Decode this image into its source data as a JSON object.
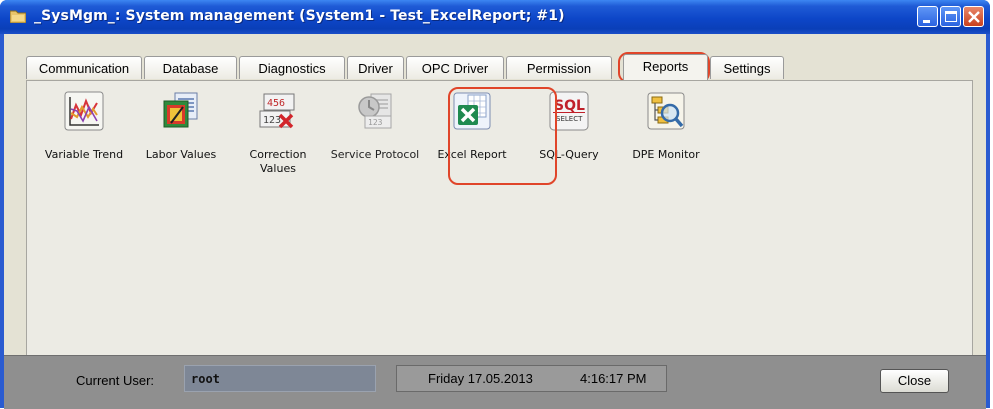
{
  "window": {
    "title": "_SysMgm_: System management (System1 - Test_ExcelReport; #1)",
    "icons": [
      "folder-app-icon",
      "minimize-icon",
      "maximize-icon",
      "close-icon"
    ]
  },
  "tabs": [
    {
      "label": "Communication"
    },
    {
      "label": "Database"
    },
    {
      "label": "Diagnostics"
    },
    {
      "label": "Driver"
    },
    {
      "label": "OPC Driver"
    },
    {
      "label": "Permission"
    },
    {
      "label": "Reports",
      "active": true
    },
    {
      "label": "Settings"
    }
  ],
  "reports": [
    {
      "label": "Variable Trend",
      "icon": "variable-trend-icon"
    },
    {
      "label": "Labor Values",
      "icon": "labor-values-icon"
    },
    {
      "label": "Correction Values",
      "icon": "correction-values-icon"
    },
    {
      "label": "Service Protocol",
      "icon": "service-protocol-icon",
      "disabled": true
    },
    {
      "label": "Excel Report",
      "icon": "excel-report-icon",
      "highlighted": true
    },
    {
      "label": "SQL-Query",
      "icon": "sql-query-icon"
    },
    {
      "label": "DPE Monitor",
      "icon": "dpe-monitor-icon"
    }
  ],
  "status": {
    "current_user_label": "Current User:",
    "current_user": "root",
    "date": "Friday 17.05.2013",
    "time": "4:16:17 PM"
  },
  "buttons": {
    "close_label": "Close"
  },
  "colors": {
    "title_bar": "#0d46c8",
    "highlight": "#e0452a",
    "status_bar": "#8f8f8f"
  }
}
